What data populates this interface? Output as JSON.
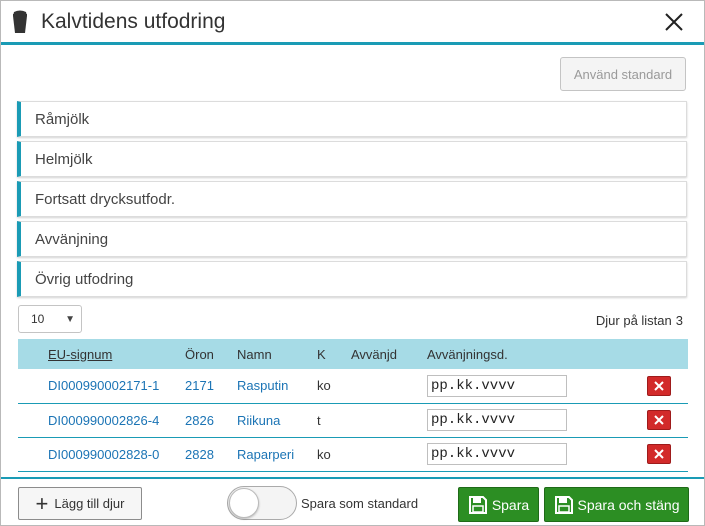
{
  "dialog": {
    "title": "Kalvtidens utfodring",
    "icon": "bucket-icon",
    "close_icon": "close-icon"
  },
  "toolbar": {
    "use_standard_label": "Använd standard"
  },
  "accordion": {
    "items": [
      {
        "label": "Råmjölk"
      },
      {
        "label": "Helmjölk"
      },
      {
        "label": "Fortsatt drycksutfodr."
      },
      {
        "label": "Avvänjning"
      },
      {
        "label": "Övrig utfodring"
      }
    ]
  },
  "list": {
    "page_size": "10",
    "count_label": "Djur på listan",
    "count": "3",
    "columns": [
      "EU-signum",
      "Öron",
      "Namn",
      "K",
      "Avvänjd",
      "Avvänjningsd."
    ],
    "rows": [
      {
        "eu": "DI000990002171-1",
        "oron": "2171",
        "namn": "Rasputin",
        "k": "ko",
        "avvanjd": "",
        "date": "pp.kk.vvvv"
      },
      {
        "eu": "DI000990002826-4",
        "oron": "2826",
        "namn": "Riikuna",
        "k": "t",
        "avvanjd": "",
        "date": "pp.kk.vvvv"
      },
      {
        "eu": "DI000990002828-0",
        "oron": "2828",
        "namn": "Raparperi",
        "k": "ko",
        "avvanjd": "",
        "date": "pp.kk.vvvv"
      }
    ]
  },
  "footer": {
    "add_animal_label": "Lägg till djur",
    "save_as_standard_label": "Spara som standard",
    "save_label": "Spara",
    "save_close_label": "Spara och stäng"
  },
  "colors": {
    "accent": "#1a9bb5",
    "header_row": "#a6dbe6",
    "link": "#1b74b5",
    "delete": "#d22a2a",
    "save": "#2c8e23"
  }
}
